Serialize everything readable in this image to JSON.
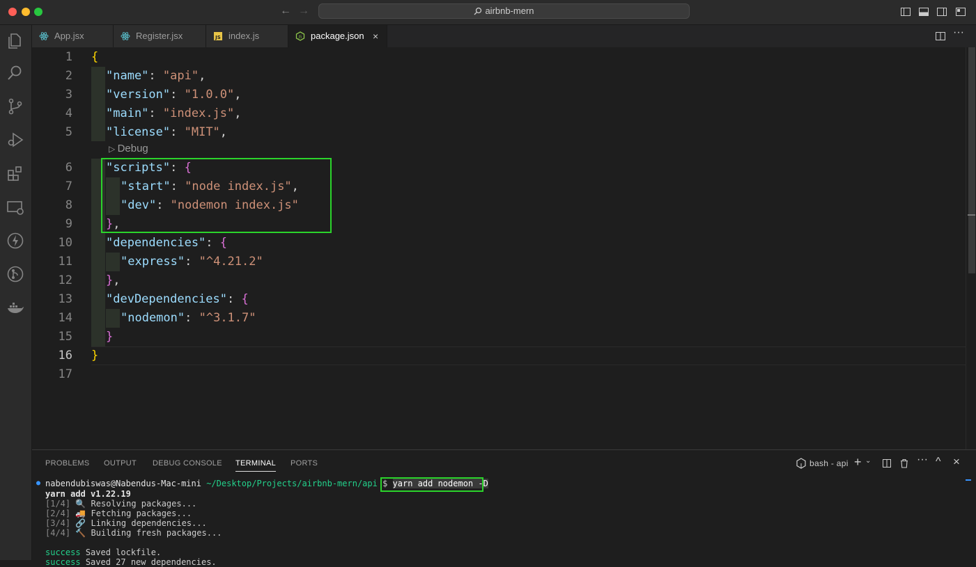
{
  "window": {
    "title": "airbnb-mern",
    "traffic_lights": {
      "close": "#ff5f57",
      "minimize": "#febc2e",
      "maximize": "#28c840"
    }
  },
  "tabs": [
    {
      "label": "App.jsx",
      "icon": "react-icon",
      "active": false
    },
    {
      "label": "Register.jsx",
      "icon": "react-icon",
      "active": false
    },
    {
      "label": "index.js",
      "icon": "js-file-icon",
      "active": false
    },
    {
      "label": "package.json",
      "icon": "json-file-icon",
      "active": true,
      "close": "×"
    }
  ],
  "editor": {
    "line_numbers": [
      "1",
      "2",
      "3",
      "4",
      "5",
      "6",
      "7",
      "8",
      "9",
      "10",
      "11",
      "12",
      "13",
      "14",
      "15",
      "16",
      "17"
    ],
    "current_line": 16,
    "codelens": "Debug",
    "tokens": {
      "l1_brace": "{",
      "name_key": "\"name\"",
      "name_val": "\"api\"",
      "version_key": "\"version\"",
      "version_val": "\"1.0.0\"",
      "main_key": "\"main\"",
      "main_val": "\"index.js\"",
      "license_key": "\"license\"",
      "license_val": "\"MIT\"",
      "scripts_key": "\"scripts\"",
      "open_brace": "{",
      "start_key": "\"start\"",
      "start_val": "\"node index.js\"",
      "dev_key": "\"dev\"",
      "dev_val": "\"nodemon index.js\"",
      "close_brace": "}",
      "deps_key": "\"dependencies\"",
      "express_key": "\"express\"",
      "express_val": "\"^4.21.2\"",
      "devdeps_key": "\"devDependencies\"",
      "nodemon_key": "\"nodemon\"",
      "nodemon_val": "\"^3.1.7\"",
      "l16_brace": "}",
      "colon": ": ",
      "comma": ","
    }
  },
  "panel": {
    "tabs": [
      "PROBLEMS",
      "OUTPUT",
      "DEBUG CONSOLE",
      "TERMINAL",
      "PORTS"
    ],
    "active_tab": "TERMINAL",
    "terminal_name": "bash - api",
    "terminal": {
      "user_host": "nabendubiswas@Nabendus-Mac-mini",
      "path": "~/Desktop/Projects/airbnb-mern/api",
      "prompt": "$",
      "command": "yarn add nodemon -D",
      "yarn_version": "yarn add v1.22.19",
      "steps": [
        {
          "n": "[1/4]",
          "emoji": "🔍",
          "text": "Resolving packages..."
        },
        {
          "n": "[2/4]",
          "emoji": "🚚",
          "text": "Fetching packages..."
        },
        {
          "n": "[3/4]",
          "emoji": "🔗",
          "text": "Linking dependencies..."
        },
        {
          "n": "[4/4]",
          "emoji": "🔨",
          "text": "Building fresh packages..."
        }
      ],
      "success_label": "success",
      "success_1": "Saved lockfile.",
      "success_2": "Saved 27 new dependencies."
    }
  },
  "colors": {
    "highlight_box": "#2bd42b",
    "key": "#9cdcfe",
    "string": "#ce9178",
    "success": "#23d18b"
  }
}
